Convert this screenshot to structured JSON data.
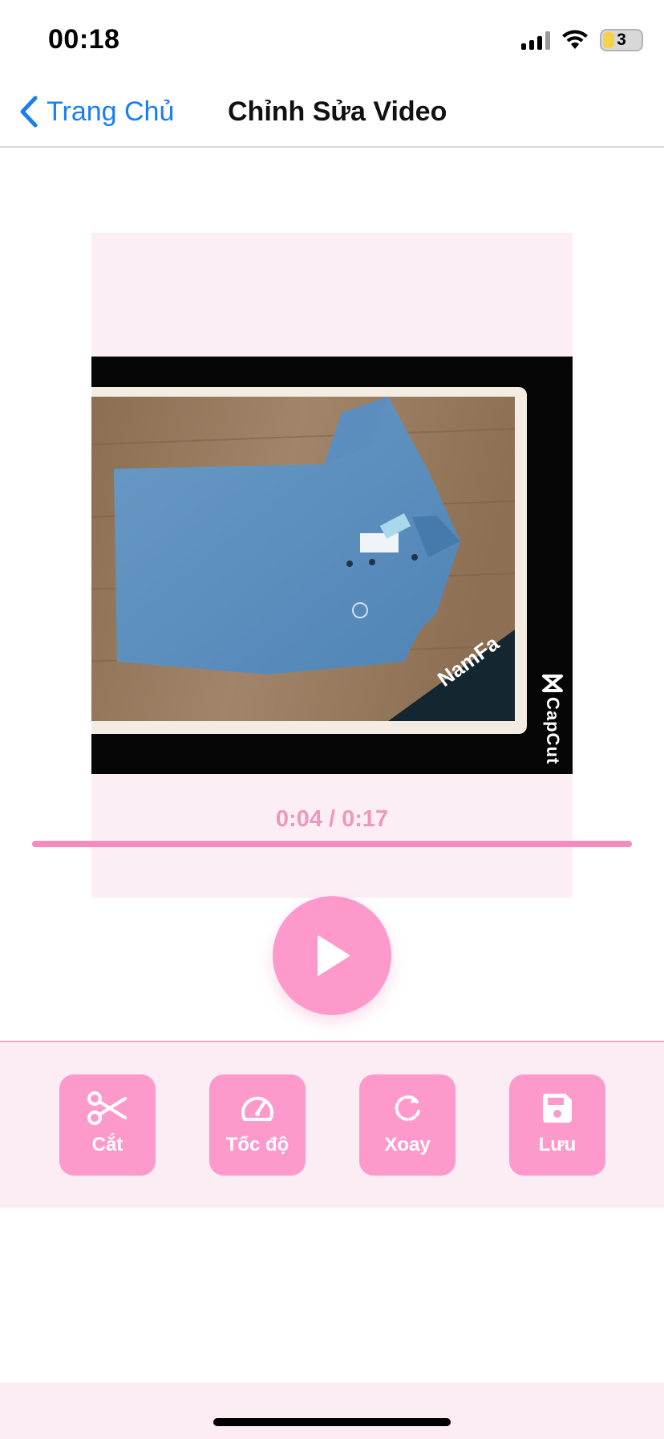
{
  "status_bar": {
    "time": "00:18",
    "battery": "3"
  },
  "nav": {
    "back_label": "Trang Chủ",
    "title": "Chỉnh Sửa Video"
  },
  "video": {
    "watermark": "CapCut",
    "current_time": "0:04",
    "duration": "0:17",
    "time_display": "0:04 / 0:17",
    "progress_fraction": 1.0
  },
  "player": {
    "play_icon": "play-icon"
  },
  "toolbar": {
    "buttons": [
      {
        "label": "Cắt",
        "icon": "scissors-icon"
      },
      {
        "label": "Tốc độ",
        "icon": "speedometer-icon"
      },
      {
        "label": "Xoay",
        "icon": "rotate-icon"
      },
      {
        "label": "Lưu",
        "icon": "save-icon"
      }
    ]
  },
  "colors": {
    "accent_pink": "#fe9acb",
    "light_pink_bg": "#fcedf4",
    "link_blue": "#1a7ef0"
  }
}
